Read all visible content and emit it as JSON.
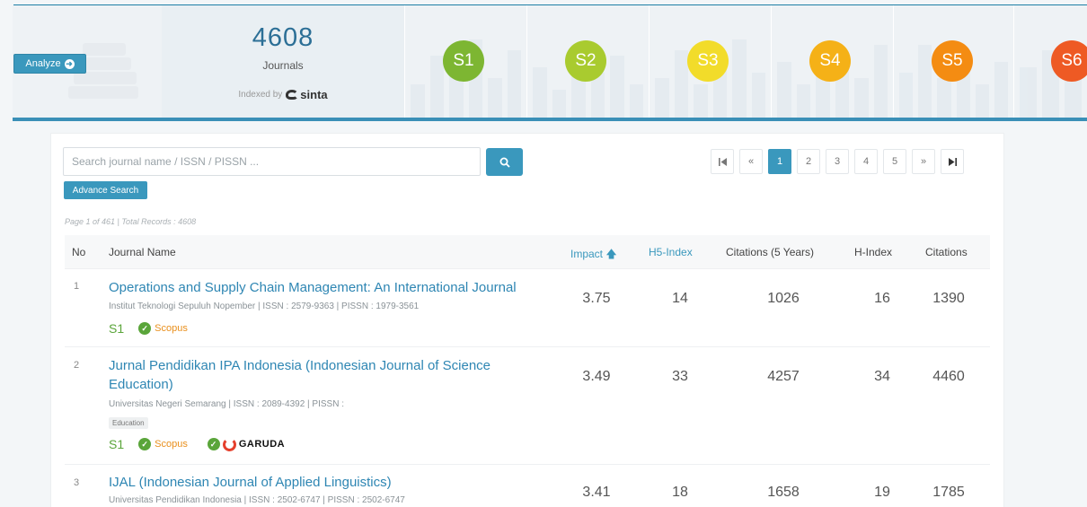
{
  "header": {
    "analyze_label": "Analyze",
    "total_number": "4608",
    "total_label": "Journals",
    "indexed_by": "Indexed by",
    "indexer_name": "sinta",
    "badges": [
      {
        "label": "S1",
        "color": "#7db632"
      },
      {
        "label": "S2",
        "color": "#a9cb2f"
      },
      {
        "label": "S3",
        "color": "#f2dc2a"
      },
      {
        "label": "S4",
        "color": "#f5b117"
      },
      {
        "label": "S5",
        "color": "#f48c12"
      },
      {
        "label": "S6",
        "color": "#ee5a24"
      }
    ]
  },
  "search": {
    "placeholder": "Search journal name / ISSN / PISSN ...",
    "advance_label": "Advance Search"
  },
  "pagination": {
    "first": "⏮",
    "prev": "«",
    "pages": [
      "1",
      "2",
      "3",
      "4",
      "5"
    ],
    "active_page": "1",
    "next": "»",
    "last": "⏭"
  },
  "page_info": "Page 1 of 461 | Total Records : 4608",
  "table": {
    "headers": {
      "no": "No",
      "name": "Journal Name",
      "impact": "Impact",
      "h5": "H5-Index",
      "cit5": "Citations (5 Years)",
      "hindex": "H-Index",
      "citations": "Citations"
    },
    "rows": [
      {
        "no": "1",
        "title": "Operations and Supply Chain Management: An International Journal",
        "meta": "Institut Teknologi Sepuluh Nopember | ISSN : 2579-9363 | PISSN : 1979-3561",
        "rank": "S1",
        "scopus": "Scopus",
        "impact": "3.75",
        "h5": "14",
        "cit5": "1026",
        "hindex": "16",
        "citations": "1390"
      },
      {
        "no": "2",
        "title": "Jurnal Pendidikan IPA Indonesia (Indonesian Journal of Science",
        "title2": "Education)",
        "meta": "Universitas Negeri Semarang | ISSN : 2089-4392 | PISSN :",
        "subject": "Education",
        "rank": "S1",
        "scopus": "Scopus",
        "garuda": "GARUDA",
        "impact": "3.49",
        "h5": "33",
        "cit5": "4257",
        "hindex": "34",
        "citations": "4460"
      },
      {
        "no": "3",
        "title": "IJAL (Indonesian Journal of Applied Linguistics)",
        "meta": "Universitas Pendidikan Indonesia | ISSN : 2502-6747 | PISSN : 2502-6747",
        "impact": "3.41",
        "h5": "18",
        "cit5": "1658",
        "hindex": "19",
        "citations": "1785"
      }
    ]
  }
}
